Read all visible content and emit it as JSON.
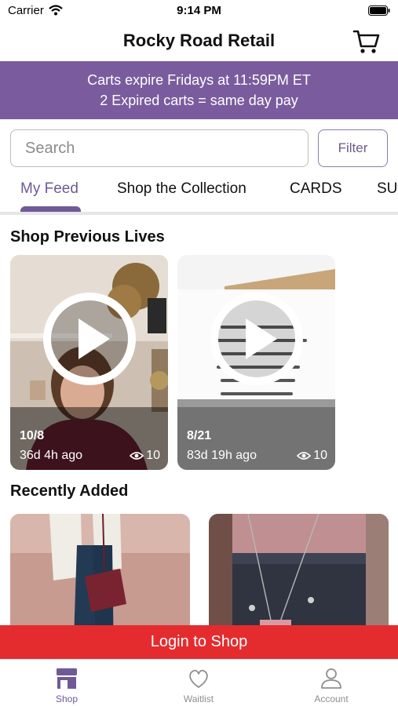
{
  "status_bar": {
    "carrier": "Carrier",
    "time": "9:14 PM"
  },
  "nav": {
    "title": "Rocky Road Retail",
    "cart_icon": "shopping-cart-icon"
  },
  "notice": {
    "line1": "Carts expire Fridays at 11:59PM ET",
    "line2": "2 Expired carts = same day pay"
  },
  "search": {
    "placeholder": "Search",
    "value": "",
    "filter_label": "Filter"
  },
  "tabs": [
    {
      "label": "My Feed",
      "active": true
    },
    {
      "label": "Shop the Collection",
      "active": false
    },
    {
      "label": "CARDS",
      "active": false
    },
    {
      "label": "SU",
      "active": false
    }
  ],
  "previous_lives": {
    "title": "Shop Previous Lives",
    "videos": [
      {
        "date": "10/8",
        "age": "36d 4h ago",
        "views": "10"
      },
      {
        "date": "8/21",
        "age": "83d 19h ago",
        "views": "10"
      }
    ]
  },
  "recently_added": {
    "title": "Recently Added"
  },
  "login": {
    "label": "Login to Shop"
  },
  "bottom_nav": {
    "items": [
      {
        "label": "Shop",
        "icon": "storefront-icon",
        "active": true
      },
      {
        "label": "Waitlist",
        "icon": "heart-icon",
        "active": false
      },
      {
        "label": "Account",
        "icon": "person-icon",
        "active": false
      }
    ]
  },
  "colors": {
    "brand_purple": "#7a5c9e",
    "active_tab": "#6f5a97",
    "login_red": "#e42c2f"
  }
}
